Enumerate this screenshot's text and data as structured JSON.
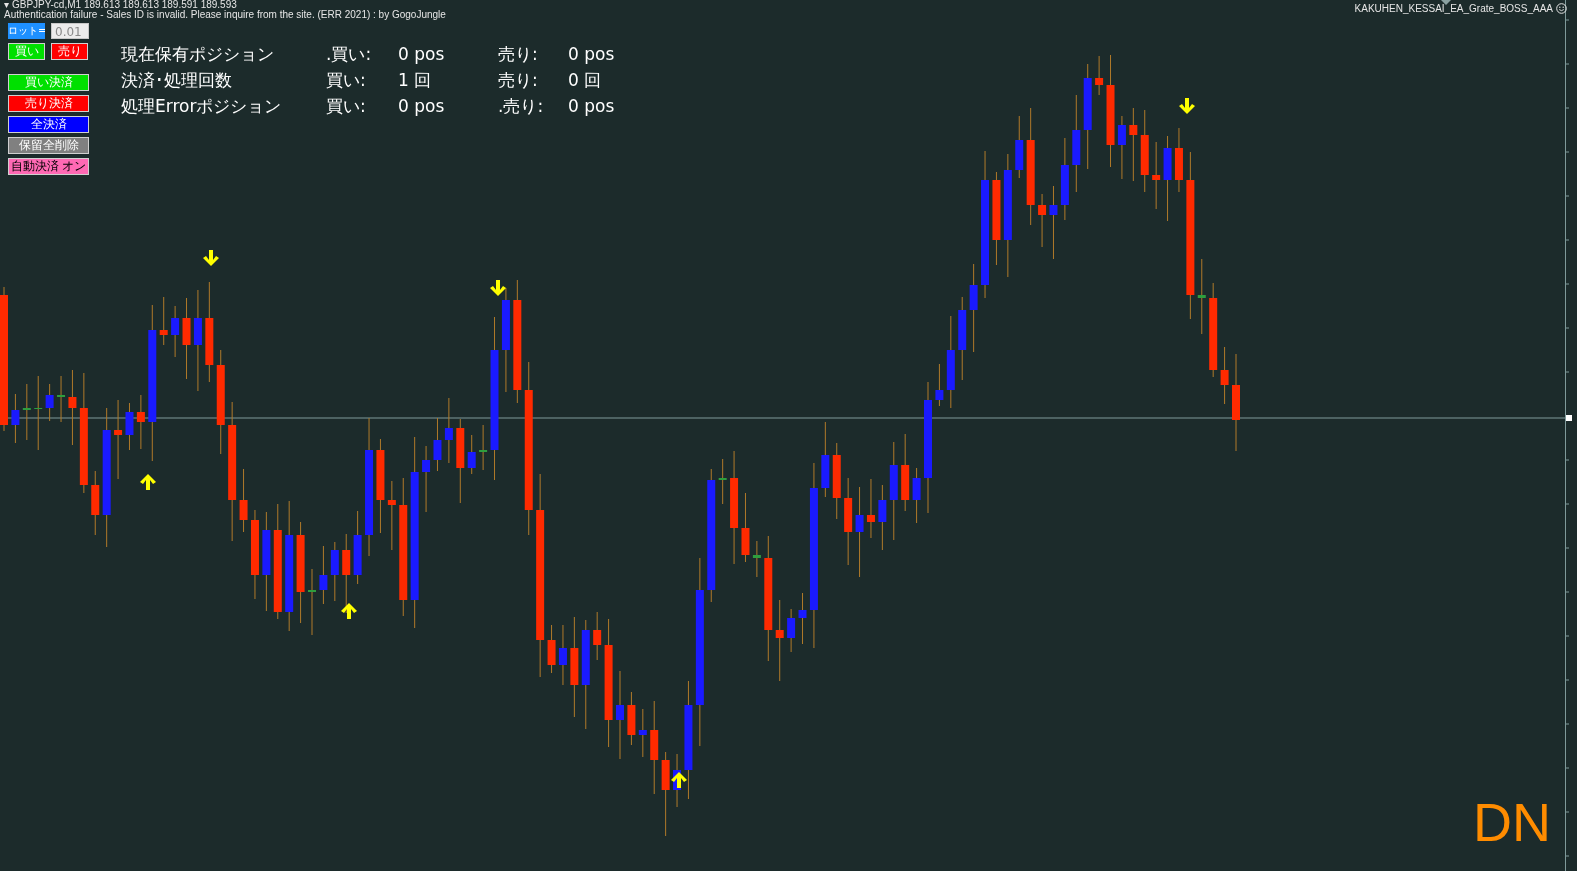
{
  "chart_header": {
    "menu_glyph": "▾",
    "symbol_line": "GBPJPY-cd,M1  189.613 189.613 189.591 189.593",
    "message": "Authentication failure - Sales ID is invalid. Please inquire from the site. (ERR 2021) : by GogoJungle",
    "expert_name": "KAKUHEN_KESSAI_EA_Grate_BOSS_AAA"
  },
  "lot": {
    "label": "ロット=",
    "value": "0.01"
  },
  "order_buttons": [
    {
      "label": "買い",
      "color": "#00e000"
    },
    {
      "label": "売り",
      "color": "#ff0000"
    }
  ],
  "action_buttons": [
    {
      "label": "買い決済",
      "color": "#00e000"
    },
    {
      "label": "売り決済",
      "color": "#ff0000"
    },
    {
      "label": "全決済",
      "color": "#0000ff"
    },
    {
      "label": "保留全削除",
      "color": "#808080"
    },
    {
      "label": "自動決済 オン",
      "color": "#ff69b4"
    }
  ],
  "stats": [
    {
      "label": "現在保有ポジション",
      "buy_label": ".買い:",
      "buy_value": "0 pos",
      "sell_label": "売り:",
      "sell_value": "0 pos"
    },
    {
      "label": "決済･処理回数",
      "buy_label": "買い:",
      "buy_value": "1 回",
      "sell_label": "売り:",
      "sell_value": "0 回"
    },
    {
      "label": "処理Errorポジション",
      "buy_label": "買い:",
      "buy_value": "0 pos",
      "sell_label": ".売り:",
      "sell_value": "0 pos"
    }
  ],
  "signal": "DN"
}
